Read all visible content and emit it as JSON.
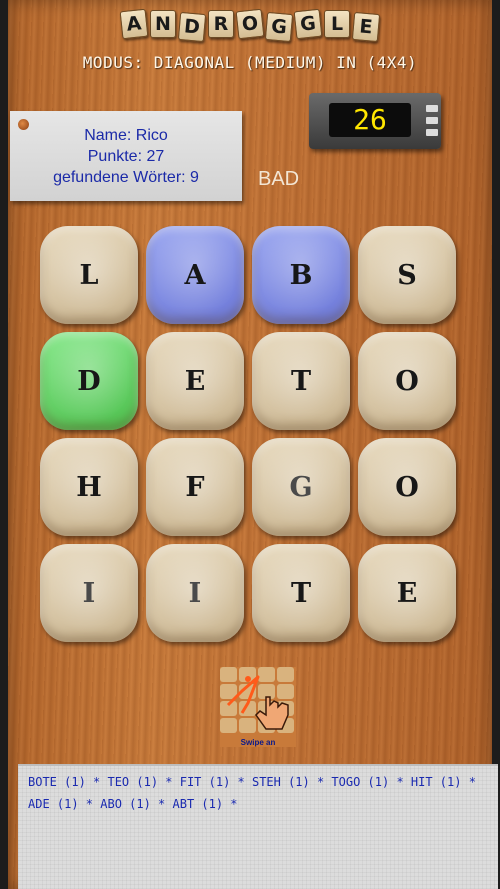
{
  "app": {
    "title_letters": [
      "A",
      "N",
      "D",
      "R",
      "O",
      "G",
      "G",
      "L",
      "E"
    ]
  },
  "mode_text": "MODUS: DIAGONAL (MEDIUM) IN (4X4)",
  "info": {
    "name": "Name: Rico",
    "points": "Punkte: 27",
    "found": "gefundene Wörter: 9"
  },
  "timer": {
    "value": "26"
  },
  "status": "BAD",
  "board": {
    "cells": [
      {
        "letter": "L",
        "state": "normal"
      },
      {
        "letter": "A",
        "state": "selected-blue"
      },
      {
        "letter": "B",
        "state": "selected-blue"
      },
      {
        "letter": "S",
        "state": "normal"
      },
      {
        "letter": "D",
        "state": "selected-green"
      },
      {
        "letter": "E",
        "state": "normal"
      },
      {
        "letter": "T",
        "state": "normal"
      },
      {
        "letter": "O",
        "state": "normal"
      },
      {
        "letter": "H",
        "state": "normal"
      },
      {
        "letter": "F",
        "state": "normal"
      },
      {
        "letter": "G",
        "state": "normal"
      },
      {
        "letter": "O",
        "state": "normal"
      },
      {
        "letter": "I",
        "state": "normal"
      },
      {
        "letter": "I",
        "state": "normal"
      },
      {
        "letter": "T",
        "state": "normal"
      },
      {
        "letter": "E",
        "state": "normal"
      }
    ]
  },
  "swipe": {
    "label": "Swipe an",
    "icon": "swipe-gesture-icon"
  },
  "found_words": "BOTE (1) * TEO (1) * FIT (1) * STEH (1) * TOGO (1) * HIT (1) * ADE (1) * ABO (1) * ABT (1) *",
  "colors": {
    "selected_blue": "#7f8be3",
    "selected_green": "#66d566",
    "info_text": "#1b2aa8",
    "timer_digits": "#ffe600"
  }
}
